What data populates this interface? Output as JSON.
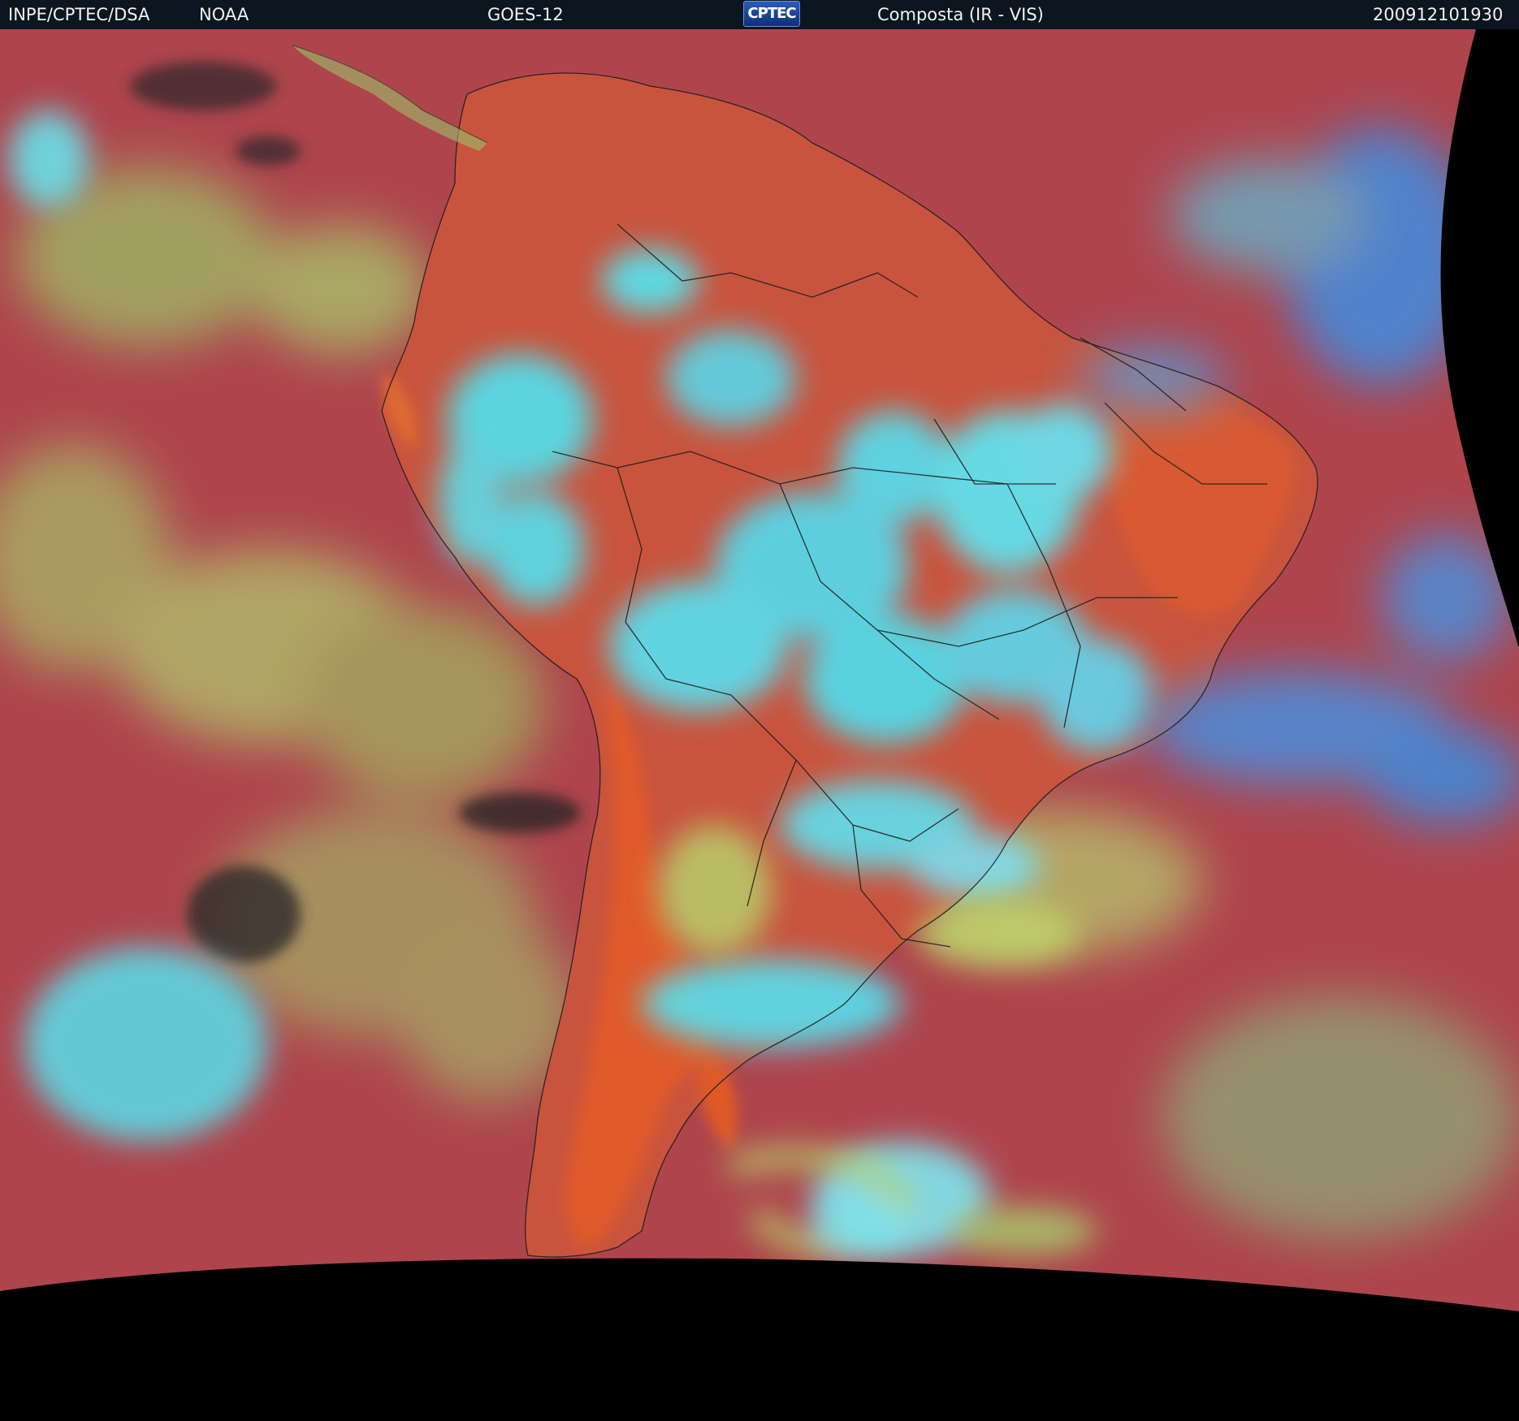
{
  "header": {
    "agency": "INPE/CPTEC/DSA",
    "source": "NOAA",
    "satellite": "GOES-12",
    "logo_text": "CPTEC",
    "product": "Composta (IR - VIS)",
    "timestamp": "200912101930"
  },
  "colors": {
    "header_bg": "#0b1620",
    "ocean_base": "#b5464a",
    "land_warm": "#e06030",
    "cloud_high": "#4fe6f0",
    "cloud_low": "#b6d770",
    "cloud_deep": "#3a8ce0",
    "no_data": "#000000",
    "borders": "#1a1a1a"
  }
}
